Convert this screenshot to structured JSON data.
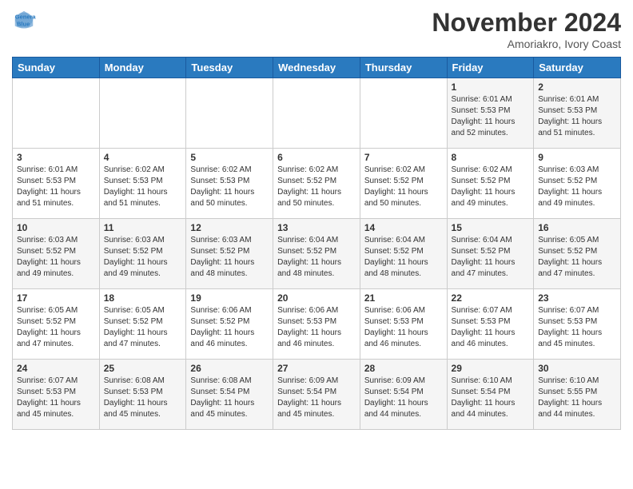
{
  "header": {
    "logo_line1": "General",
    "logo_line2": "Blue",
    "month_title": "November 2024",
    "location": "Amoriakro, Ivory Coast"
  },
  "weekdays": [
    "Sunday",
    "Monday",
    "Tuesday",
    "Wednesday",
    "Thursday",
    "Friday",
    "Saturday"
  ],
  "weeks": [
    [
      {
        "day": "",
        "info": ""
      },
      {
        "day": "",
        "info": ""
      },
      {
        "day": "",
        "info": ""
      },
      {
        "day": "",
        "info": ""
      },
      {
        "day": "",
        "info": ""
      },
      {
        "day": "1",
        "info": "Sunrise: 6:01 AM\nSunset: 5:53 PM\nDaylight: 11 hours\nand 52 minutes."
      },
      {
        "day": "2",
        "info": "Sunrise: 6:01 AM\nSunset: 5:53 PM\nDaylight: 11 hours\nand 51 minutes."
      }
    ],
    [
      {
        "day": "3",
        "info": "Sunrise: 6:01 AM\nSunset: 5:53 PM\nDaylight: 11 hours\nand 51 minutes."
      },
      {
        "day": "4",
        "info": "Sunrise: 6:02 AM\nSunset: 5:53 PM\nDaylight: 11 hours\nand 51 minutes."
      },
      {
        "day": "5",
        "info": "Sunrise: 6:02 AM\nSunset: 5:53 PM\nDaylight: 11 hours\nand 50 minutes."
      },
      {
        "day": "6",
        "info": "Sunrise: 6:02 AM\nSunset: 5:52 PM\nDaylight: 11 hours\nand 50 minutes."
      },
      {
        "day": "7",
        "info": "Sunrise: 6:02 AM\nSunset: 5:52 PM\nDaylight: 11 hours\nand 50 minutes."
      },
      {
        "day": "8",
        "info": "Sunrise: 6:02 AM\nSunset: 5:52 PM\nDaylight: 11 hours\nand 49 minutes."
      },
      {
        "day": "9",
        "info": "Sunrise: 6:03 AM\nSunset: 5:52 PM\nDaylight: 11 hours\nand 49 minutes."
      }
    ],
    [
      {
        "day": "10",
        "info": "Sunrise: 6:03 AM\nSunset: 5:52 PM\nDaylight: 11 hours\nand 49 minutes."
      },
      {
        "day": "11",
        "info": "Sunrise: 6:03 AM\nSunset: 5:52 PM\nDaylight: 11 hours\nand 49 minutes."
      },
      {
        "day": "12",
        "info": "Sunrise: 6:03 AM\nSunset: 5:52 PM\nDaylight: 11 hours\nand 48 minutes."
      },
      {
        "day": "13",
        "info": "Sunrise: 6:04 AM\nSunset: 5:52 PM\nDaylight: 11 hours\nand 48 minutes."
      },
      {
        "day": "14",
        "info": "Sunrise: 6:04 AM\nSunset: 5:52 PM\nDaylight: 11 hours\nand 48 minutes."
      },
      {
        "day": "15",
        "info": "Sunrise: 6:04 AM\nSunset: 5:52 PM\nDaylight: 11 hours\nand 47 minutes."
      },
      {
        "day": "16",
        "info": "Sunrise: 6:05 AM\nSunset: 5:52 PM\nDaylight: 11 hours\nand 47 minutes."
      }
    ],
    [
      {
        "day": "17",
        "info": "Sunrise: 6:05 AM\nSunset: 5:52 PM\nDaylight: 11 hours\nand 47 minutes."
      },
      {
        "day": "18",
        "info": "Sunrise: 6:05 AM\nSunset: 5:52 PM\nDaylight: 11 hours\nand 47 minutes."
      },
      {
        "day": "19",
        "info": "Sunrise: 6:06 AM\nSunset: 5:52 PM\nDaylight: 11 hours\nand 46 minutes."
      },
      {
        "day": "20",
        "info": "Sunrise: 6:06 AM\nSunset: 5:53 PM\nDaylight: 11 hours\nand 46 minutes."
      },
      {
        "day": "21",
        "info": "Sunrise: 6:06 AM\nSunset: 5:53 PM\nDaylight: 11 hours\nand 46 minutes."
      },
      {
        "day": "22",
        "info": "Sunrise: 6:07 AM\nSunset: 5:53 PM\nDaylight: 11 hours\nand 46 minutes."
      },
      {
        "day": "23",
        "info": "Sunrise: 6:07 AM\nSunset: 5:53 PM\nDaylight: 11 hours\nand 45 minutes."
      }
    ],
    [
      {
        "day": "24",
        "info": "Sunrise: 6:07 AM\nSunset: 5:53 PM\nDaylight: 11 hours\nand 45 minutes."
      },
      {
        "day": "25",
        "info": "Sunrise: 6:08 AM\nSunset: 5:53 PM\nDaylight: 11 hours\nand 45 minutes."
      },
      {
        "day": "26",
        "info": "Sunrise: 6:08 AM\nSunset: 5:54 PM\nDaylight: 11 hours\nand 45 minutes."
      },
      {
        "day": "27",
        "info": "Sunrise: 6:09 AM\nSunset: 5:54 PM\nDaylight: 11 hours\nand 45 minutes."
      },
      {
        "day": "28",
        "info": "Sunrise: 6:09 AM\nSunset: 5:54 PM\nDaylight: 11 hours\nand 44 minutes."
      },
      {
        "day": "29",
        "info": "Sunrise: 6:10 AM\nSunset: 5:54 PM\nDaylight: 11 hours\nand 44 minutes."
      },
      {
        "day": "30",
        "info": "Sunrise: 6:10 AM\nSunset: 5:55 PM\nDaylight: 11 hours\nand 44 minutes."
      }
    ]
  ]
}
